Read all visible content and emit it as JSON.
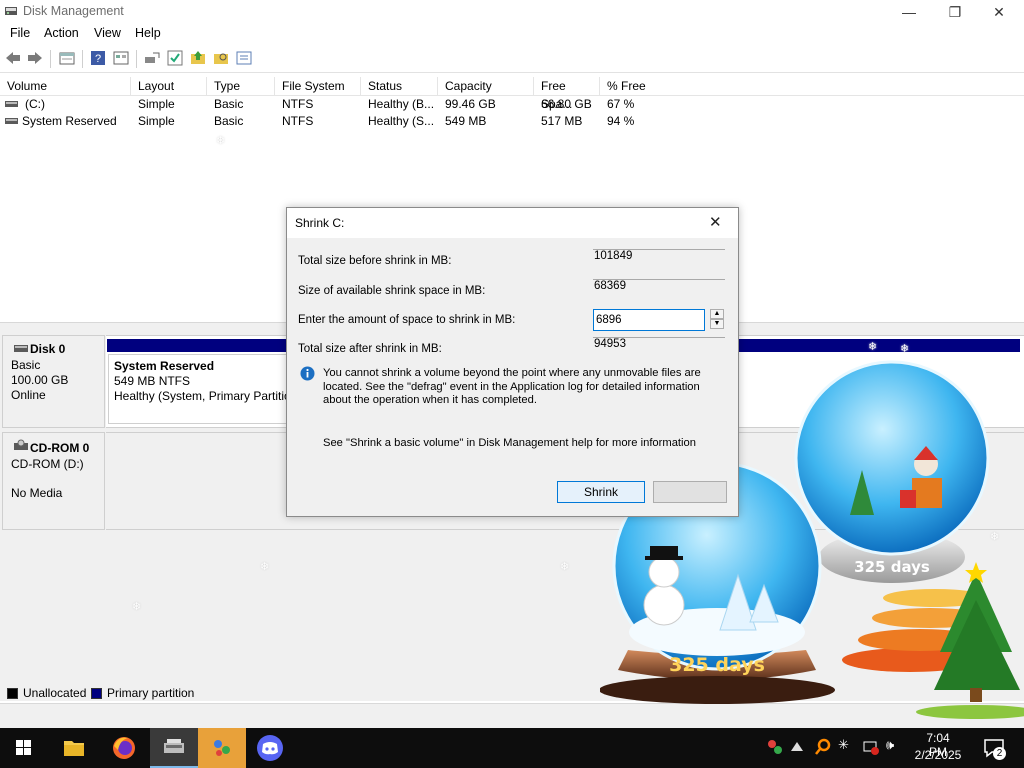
{
  "window": {
    "title": "Disk Management",
    "minimize_glyph": "—",
    "restore_glyph": "❐",
    "close_glyph": "✕"
  },
  "menu": [
    "File",
    "Action",
    "View",
    "Help"
  ],
  "toolbar_icons": [
    "back-icon",
    "forward-icon",
    "properties-icon",
    "help-icon",
    "list-view-icon",
    "connect-icon",
    "check-icon",
    "folder-up-icon",
    "folder-search-icon",
    "details-icon"
  ],
  "volume_list": {
    "columns": [
      "Volume",
      "Layout",
      "Type",
      "File System",
      "Status",
      "Capacity",
      "Free Spa...",
      "% Free"
    ],
    "rows": [
      [
        "(C:)",
        "Simple",
        "Basic",
        "NTFS",
        "Healthy (B...",
        "99.46 GB",
        "66.80 GB",
        "67 %"
      ],
      [
        "System Reserved",
        "Simple",
        "Basic",
        "NTFS",
        "Healthy (S...",
        "549 MB",
        "517 MB",
        "94 %"
      ]
    ]
  },
  "disks": [
    {
      "name": "Disk 0",
      "type": "Basic",
      "size": "100.00 GB",
      "state": "Online",
      "partition": {
        "name": "System Reserved",
        "size_fs": "549 MB NTFS",
        "status": "Healthy (System, Primary Partitio"
      }
    },
    {
      "name": "CD-ROM 0",
      "type": "CD-ROM (D:)",
      "state": "No Media"
    }
  ],
  "legend": [
    {
      "label": "Unallocated",
      "color": "#000000"
    },
    {
      "label": "Primary partition",
      "color": "#00007f"
    }
  ],
  "dialog": {
    "title": "Shrink C:",
    "close_glyph": "✕",
    "fields": [
      {
        "label": "Total size before shrink in MB:",
        "value": "101849"
      },
      {
        "label": "Size of available shrink space in MB:",
        "value": "68369"
      },
      {
        "label": "Enter the amount of space to shrink in MB:",
        "value": "6896"
      },
      {
        "label": "Total size after shrink in MB:",
        "value": "94953"
      }
    ],
    "info_text": "You cannot shrink a volume beyond the point where any unmovable files are located. See the \"defrag\" event in the Application log for detailed information about the operation when it has completed.",
    "help_text": "See \"Shrink a basic volume\" in Disk Management help for more information",
    "shrink_button": "Shrink",
    "spin_up": "▲",
    "spin_down": "▼"
  },
  "decoration": {
    "globe_caption": "325 days"
  },
  "taskbar": {
    "apps": [
      "windows-start-icon",
      "file-explorer-icon",
      "firefox-icon",
      "disk-management-icon",
      "network-app-icon",
      "discord-icon"
    ],
    "time": "7:04 PM",
    "date": "2/2/2025",
    "notification_count": "2"
  },
  "colors": {
    "primary_partition": "#00007f",
    "accent": "#0078d7",
    "taskbar": "#0d0d0d"
  }
}
